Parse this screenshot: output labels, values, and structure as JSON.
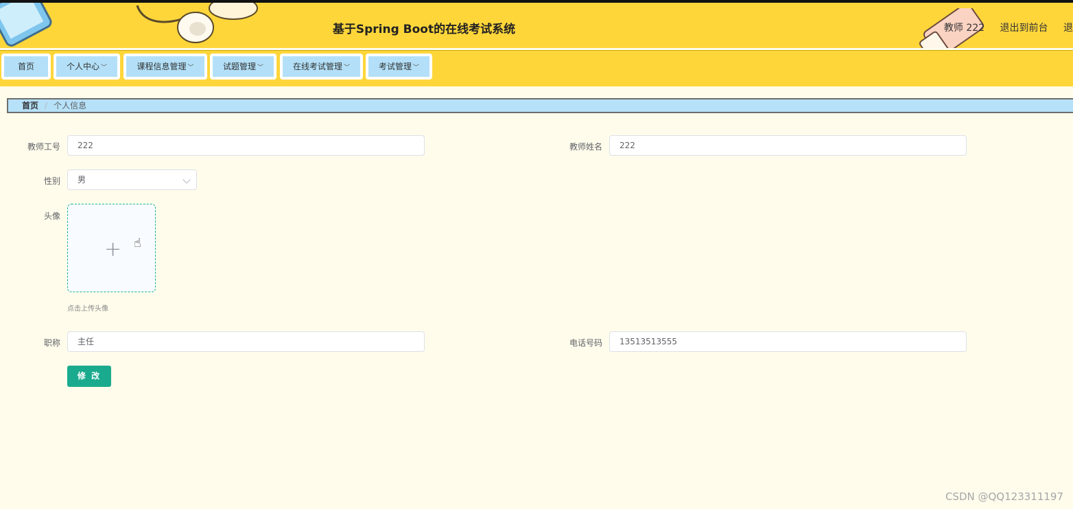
{
  "header": {
    "title": "基于Spring Boot的在线考试系统",
    "user_label": "教师 222",
    "exit_frontend": "退出到前台",
    "logout": "退"
  },
  "nav": {
    "items": [
      {
        "label": "首页"
      },
      {
        "label": "个人中心"
      },
      {
        "label": "课程信息管理"
      },
      {
        "label": "试题管理"
      },
      {
        "label": "在线考试管理"
      },
      {
        "label": "考试管理"
      }
    ]
  },
  "breadcrumb": {
    "home": "首页",
    "separator": "/",
    "current": "个人信息"
  },
  "form": {
    "teacher_id": {
      "label": "教师工号",
      "value": "222"
    },
    "teacher_name": {
      "label": "教师姓名",
      "value": "222"
    },
    "gender": {
      "label": "性别",
      "value": "男"
    },
    "avatar": {
      "label": "头像",
      "tip": "点击上传头像",
      "plus": "+"
    },
    "title": {
      "label": "职称",
      "value": "主任"
    },
    "phone": {
      "label": "电话号码",
      "value": "13513513555"
    },
    "submit_label": "修 改"
  },
  "watermark": "CSDN @QQ123311197",
  "colors": {
    "header_bg": "#ffd63a",
    "nav_item_bg": "#b3e0f8",
    "primary": "#1aaa8e",
    "page_bg": "#fffcec"
  }
}
